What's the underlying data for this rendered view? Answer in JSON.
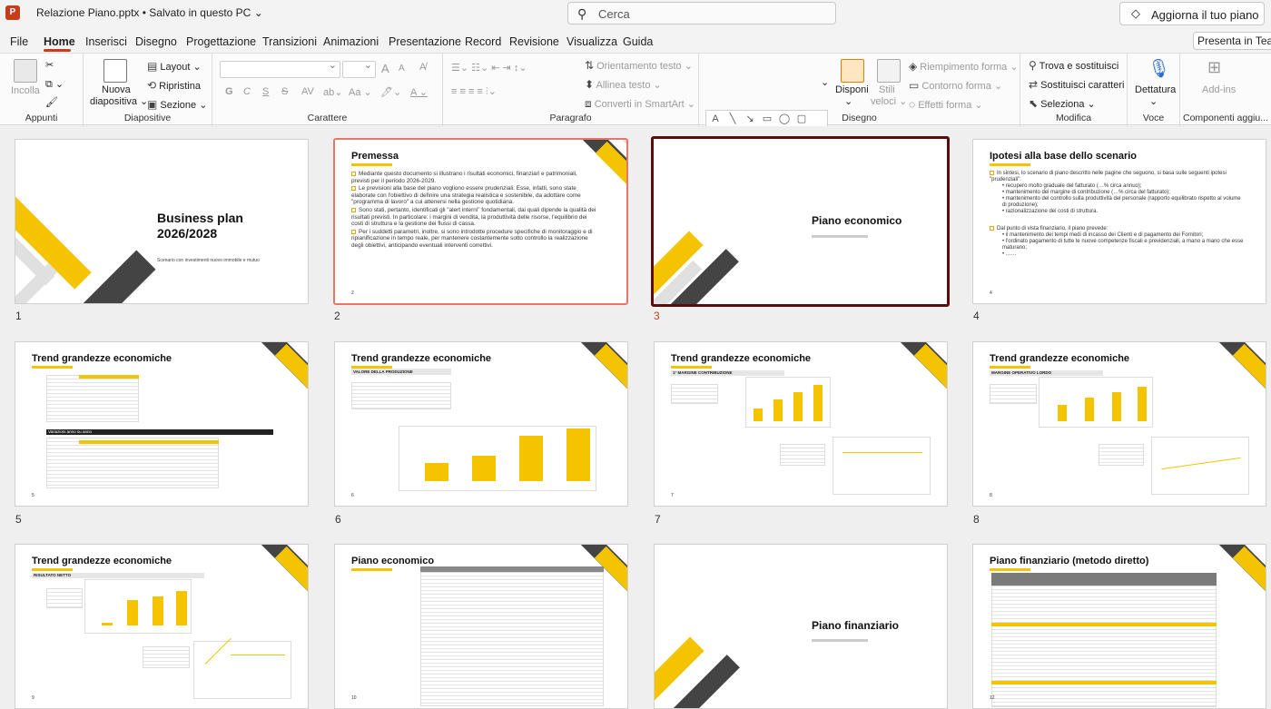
{
  "app": {
    "logo_letter": "P",
    "doc_title": "Relazione Piano.pptx • Salvato in questo PC",
    "title_chevron": "⌄"
  },
  "search": {
    "placeholder": "Cerca",
    "icon": "search-icon"
  },
  "upgrade": {
    "label": "Aggiorna il tuo piano",
    "icon": "diamond-icon"
  },
  "menu": {
    "tabs": [
      "File",
      "Home",
      "Inserisci",
      "Disegno",
      "Progettazione",
      "Transizioni",
      "Animazioni",
      "Presentazione",
      "Record",
      "Revisione",
      "Visualizza",
      "Guida"
    ],
    "active": "Home"
  },
  "present": {
    "label": "Presenta in Tea"
  },
  "ribbon": {
    "appunti": {
      "name": "Appunti",
      "paste": "Incolla"
    },
    "diapositive": {
      "name": "Diapositive",
      "new_slide": "Nuova",
      "new_slide2": "diapositiva",
      "layout": "Layout",
      "reset": "Ripristina",
      "section": "Sezione"
    },
    "carattere": {
      "name": "Carattere",
      "bold": "G",
      "italic": "C",
      "underline": "S",
      "strike": "S",
      "grow": "A",
      "shrink": "A",
      "case": "Aa",
      "font_color": "A"
    },
    "paragrafo": {
      "name": "Paragrafo",
      "orient": "Orientamento testo",
      "align": "Allinea testo",
      "smartart": "Converti in SmartArt"
    },
    "disegno": {
      "name": "Disegno",
      "arrange": "Disponi",
      "quick_styles": "Stili",
      "quick_styles2": "veloci",
      "fill": "Riempimento forma",
      "outline": "Contorno forma",
      "effects": "Effetti forma"
    },
    "modifica": {
      "name": "Modifica",
      "find": "Trova e sostituisci",
      "replace": "Sostituisci caratteri",
      "select": "Seleziona"
    },
    "voce": {
      "name": "Voce",
      "dictate": "Dettatura"
    },
    "addins": {
      "name": "Componenti aggiu...",
      "label": "Add-ins"
    }
  },
  "slides": [
    {
      "num": "1",
      "title": "Business plan",
      "title2": "2026/2028",
      "subtitle": "Scenario con investimenti nuovo immobile e mutuo"
    },
    {
      "num": "2",
      "title": "Premessa",
      "bullets": [
        "Mediante questo documento si illustrano i risultati economici, finanziari e patrimoniali, previsti per il periodo 2026-2029.",
        "Le previsioni alla base del piano vogliono essere prudenziali. Esse, infatti, sono state elaborate con l'obiettivo di definire una strategia realistica e sostenibile, da adottare come \"programma di lavoro\" a cui attenersi nella gestione quotidiana.",
        "Sono stati, pertanto, identificati gli \"alert interni\" fondamentali, dai quali dipende la qualità dei risultati previsti. In particolare: i margini di vendita, la produttività delle risorse, l'equilibrio dei costi di struttura e la gestione dei flussi di cassa.",
        "Per i suddetti parametri, inoltre, si sono introdotte procedure specifiche di monitoraggio e di ripianificazione in tempo reale, per mantenere costantemente sotto controllo la realizzazione degli obiettivi, anticipando eventuali interventi correttivi."
      ],
      "page": "2"
    },
    {
      "num": "3",
      "title": "Piano economico"
    },
    {
      "num": "4",
      "title": "Ipotesi alla base dello scenario",
      "intro": "In sintesi, lo scenario di piano descritto nelle pagine che seguono, si basa sulle seguenti ipotesi \"prudenziali\":",
      "items1": [
        "recupero molto graduale del fatturato (…% circa annuo);",
        "mantenimento del margine di contribuzione (…% circa del fatturato);",
        "mantenimento del controllo sulla produttività del personale (rapporto equilibrato rispetto al volume di produzione);",
        "razionalizzazione dei costi di struttura."
      ],
      "intro2": "Dal punto di vista finanziario, il piano prevede:",
      "items2": [
        "il mantenimento dei tempi medi di incasso dei Clienti e di pagamento dei Fornitori;",
        "l'ordinato pagamento di tutte le nuove competenze fiscali e previdenziali, a mano a mano che esse maturano;",
        "……"
      ],
      "page": "4"
    },
    {
      "num": "5",
      "title": "Trend grandezze economiche",
      "table_title": "Variazioni anno su anno",
      "page": "5"
    },
    {
      "num": "6",
      "title": "Trend grandezze economiche",
      "section": "VALORE DELLA PRODUZIONE",
      "page": "6"
    },
    {
      "num": "7",
      "title": "Trend grandezze economiche",
      "section": "1° MARGINE CONTRIBUZIONE",
      "page": "7"
    },
    {
      "num": "8",
      "title": "Trend grandezze economiche",
      "section": "MARGINE OPERATIVO LORDO",
      "page": "8"
    },
    {
      "num": "9",
      "title": "Trend grandezze economiche",
      "section": "RISULTATO NETTO",
      "page": "9"
    },
    {
      "num": "10",
      "title": "Piano economico",
      "page": "10"
    },
    {
      "num": "11",
      "title": "Piano finanziario"
    },
    {
      "num": "12",
      "title": "Piano finanziario (metodo diretto)",
      "page": "12"
    }
  ],
  "colors": {
    "accent": "#c43e1c",
    "yellow": "#f5c400",
    "dark": "#444444",
    "selected_border": "#5a0d0d"
  }
}
